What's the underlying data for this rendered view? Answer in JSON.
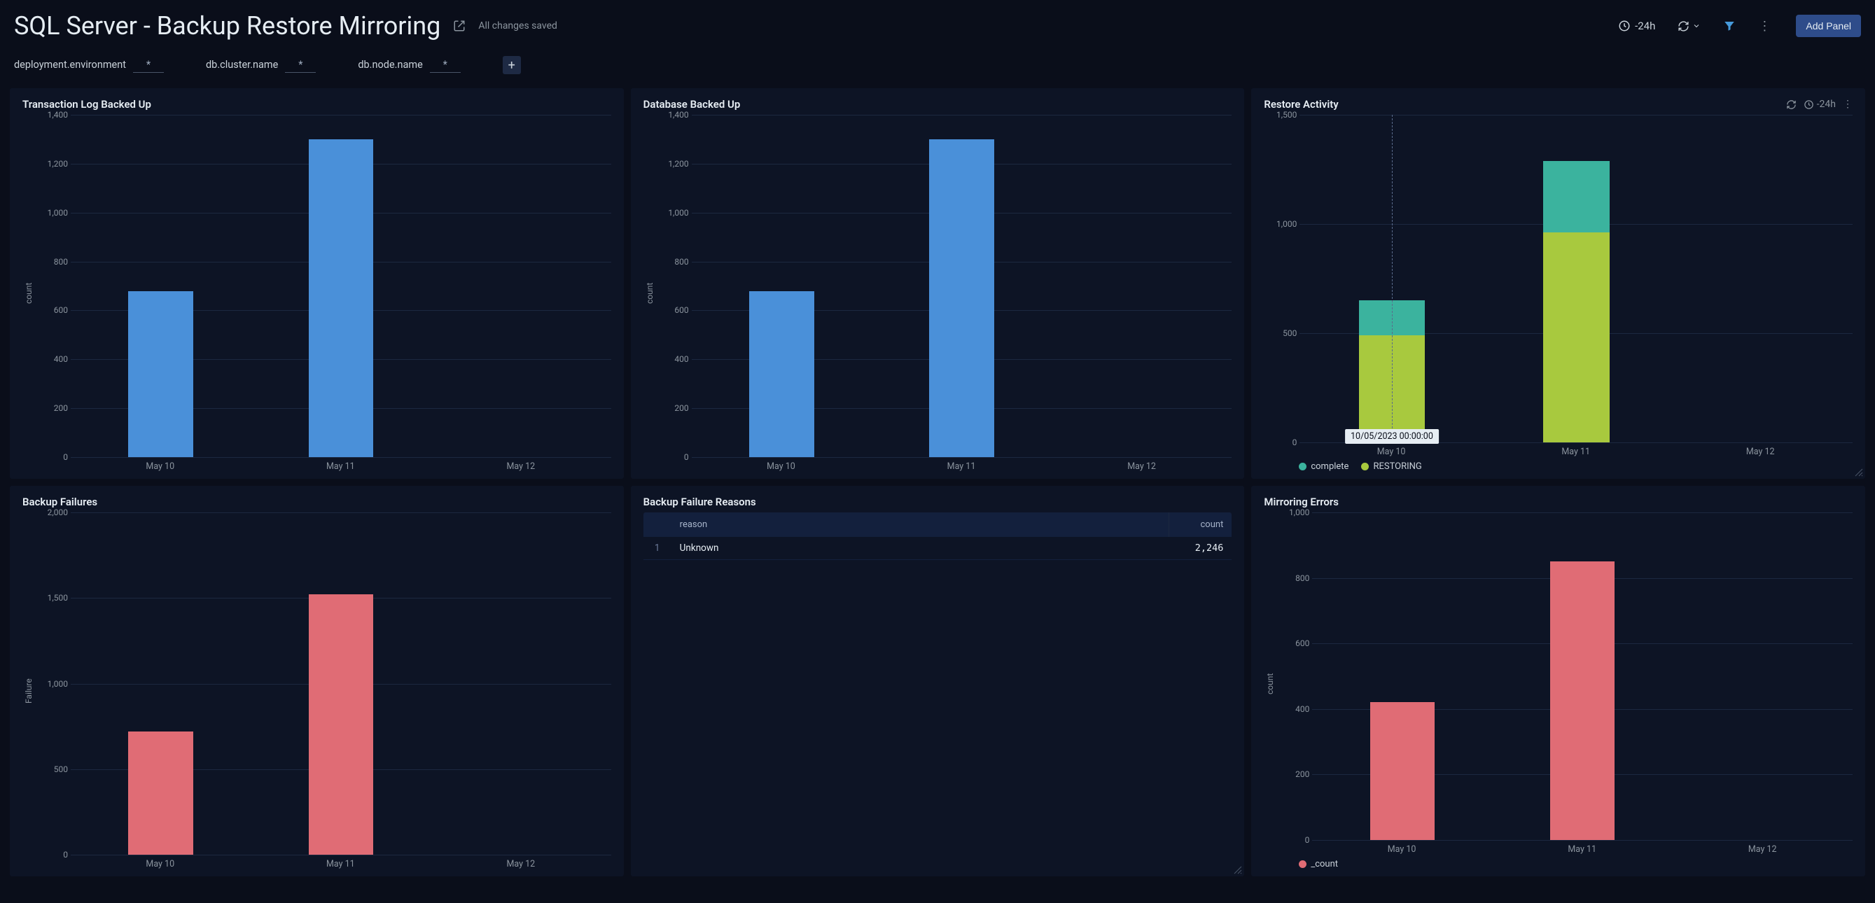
{
  "header": {
    "title": "SQL Server - Backup Restore Mirroring",
    "saved_text": "All changes saved",
    "time_range": "-24h",
    "add_panel": "Add Panel"
  },
  "filters": [
    {
      "label": "deployment.environment",
      "value": "*"
    },
    {
      "label": "db.cluster.name",
      "value": "*"
    },
    {
      "label": "db.node.name",
      "value": "*"
    }
  ],
  "panels": {
    "tlog": {
      "title": "Transaction Log Backed Up",
      "ylabel": "count"
    },
    "dbbackup": {
      "title": "Database Backed Up",
      "ylabel": "count"
    },
    "restore": {
      "title": "Restore Activity",
      "time_range": "-24h",
      "legend": {
        "complete": "complete",
        "restoring": "RESTORING"
      },
      "hover_tip": "10/05/2023 00:00:00"
    },
    "failures": {
      "title": "Backup Failures",
      "ylabel": "Failure"
    },
    "reasons": {
      "title": "Backup Failure Reasons",
      "cols": {
        "reason": "reason",
        "count": "count"
      },
      "rows": [
        {
          "idx": "1",
          "reason": "Unknown",
          "count": "2,246"
        }
      ]
    },
    "mirror": {
      "title": "Mirroring Errors",
      "ylabel": "count",
      "legend": "_count"
    }
  },
  "chart_data": [
    {
      "id": "tlog",
      "type": "bar",
      "title": "Transaction Log Backed Up",
      "ylabel": "count",
      "categories": [
        "May 10",
        "May 11",
        "May 12"
      ],
      "values": [
        680,
        1300,
        0
      ],
      "ylim": [
        0,
        1400
      ],
      "yticks": [
        0,
        200,
        400,
        600,
        800,
        1000,
        1200,
        1400
      ],
      "ytick_labels": [
        "0",
        "200",
        "400",
        "600",
        "800",
        "1,000",
        "1,200",
        "1,400"
      ],
      "color": "#4a90d9"
    },
    {
      "id": "dbbackup",
      "type": "bar",
      "title": "Database Backed Up",
      "ylabel": "count",
      "categories": [
        "May 10",
        "May 11",
        "May 12"
      ],
      "values": [
        680,
        1300,
        0
      ],
      "ylim": [
        0,
        1400
      ],
      "yticks": [
        0,
        200,
        400,
        600,
        800,
        1000,
        1200,
        1400
      ],
      "ytick_labels": [
        "0",
        "200",
        "400",
        "600",
        "800",
        "1,000",
        "1,200",
        "1,400"
      ],
      "color": "#4a90d9"
    },
    {
      "id": "restore",
      "type": "bar",
      "stacked": true,
      "title": "Restore Activity",
      "categories": [
        "May 10",
        "May 11",
        "May 12"
      ],
      "series": [
        {
          "name": "RESTORING",
          "color": "#a8c93e",
          "values": [
            490,
            960,
            0
          ]
        },
        {
          "name": "complete",
          "color": "#3bb39e",
          "values": [
            160,
            330,
            0
          ]
        }
      ],
      "ylim": [
        0,
        1500
      ],
      "yticks": [
        0,
        500,
        1000,
        1500
      ],
      "ytick_labels": [
        "0",
        "500",
        "1,000",
        "1,500"
      ],
      "hover_x_index": 0,
      "hover_label": "10/05/2023 00:00:00"
    },
    {
      "id": "failures",
      "type": "bar",
      "title": "Backup Failures",
      "ylabel": "Failure",
      "categories": [
        "May 10",
        "May 11",
        "May 12"
      ],
      "values": [
        720,
        1520,
        0
      ],
      "ylim": [
        0,
        2000
      ],
      "yticks": [
        0,
        500,
        1000,
        1500,
        2000
      ],
      "ytick_labels": [
        "0",
        "500",
        "1,000",
        "1,500",
        "2,000"
      ],
      "color": "#e06c75"
    },
    {
      "id": "reasons",
      "type": "table",
      "title": "Backup Failure Reasons",
      "columns": [
        "reason",
        "count"
      ],
      "rows": [
        [
          "Unknown",
          2246
        ]
      ]
    },
    {
      "id": "mirror",
      "type": "bar",
      "title": "Mirroring Errors",
      "ylabel": "count",
      "categories": [
        "May 10",
        "May 11",
        "May 12"
      ],
      "series": [
        {
          "name": "_count",
          "color": "#e06c75",
          "values": [
            420,
            850,
            0
          ]
        }
      ],
      "ylim": [
        0,
        1000
      ],
      "yticks": [
        0,
        200,
        400,
        600,
        800,
        1000
      ],
      "ytick_labels": [
        "0",
        "200",
        "400",
        "600",
        "800",
        "1,000"
      ]
    }
  ]
}
